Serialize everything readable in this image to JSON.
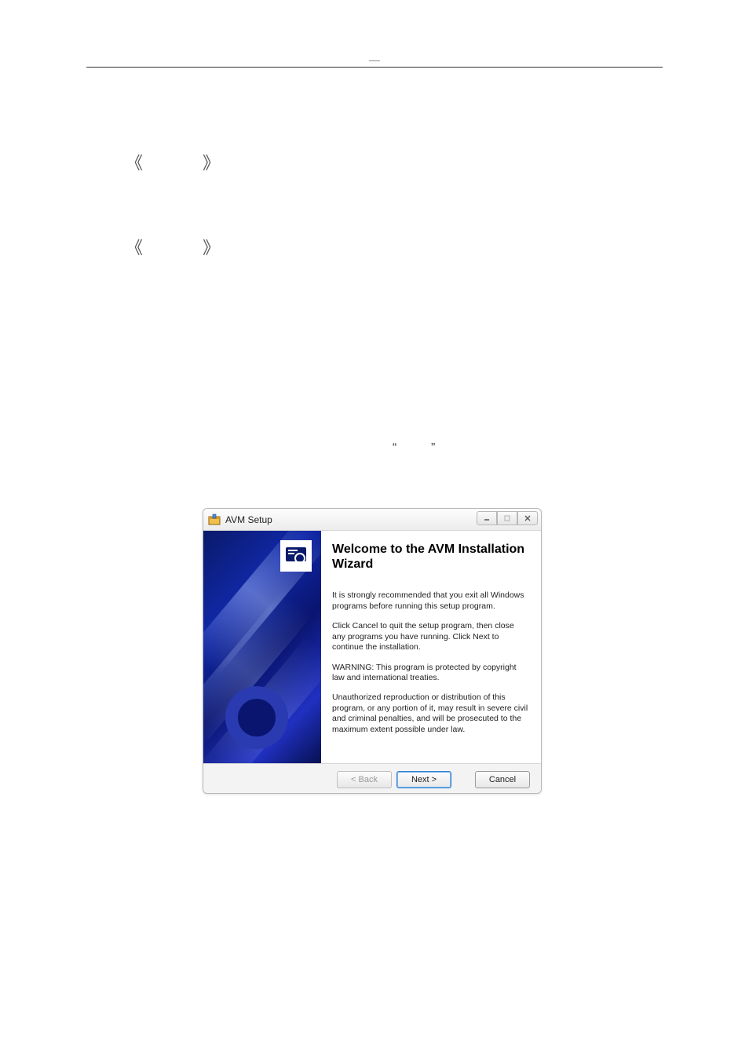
{
  "page": {
    "dash": "—",
    "angle_left_1": "《",
    "angle_right_1": "》",
    "angle_left_2": "《",
    "angle_right_2": "》",
    "quote_left": "“",
    "quote_right": "”"
  },
  "installer": {
    "title_icon_name": "installer-box-icon",
    "title": "AVM Setup",
    "window_controls": {
      "minimize": "minimize",
      "maximize": "maximize",
      "close": "close"
    },
    "content": {
      "heading": "Welcome to the AVM Installation Wizard",
      "para1": "It is strongly recommended that you exit all Windows programs before running this setup program.",
      "para2": "Click Cancel to quit the setup program, then close any programs you have running.  Click Next to continue the installation.",
      "para3": "WARNING: This program is protected by copyright law and international treaties.",
      "para4": "Unauthorized reproduction or distribution of this program, or any portion of it, may result in severe civil and criminal penalties, and will be prosecuted to the maximum extent possible under law."
    },
    "buttons": {
      "back": "< Back",
      "next": "Next >",
      "cancel": "Cancel"
    }
  }
}
